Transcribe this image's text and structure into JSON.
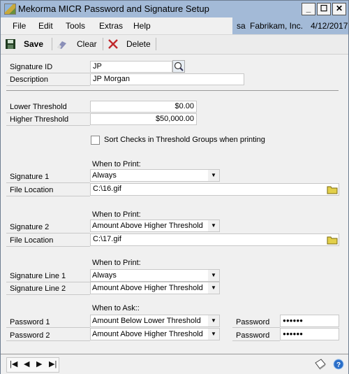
{
  "window": {
    "title": "Mekorma MICR Password and Signature Setup",
    "controls": {
      "minimize": "_",
      "maximize": "☐",
      "close": "✕"
    }
  },
  "menubar": {
    "items": [
      "File",
      "Edit",
      "Tools",
      "Extras",
      "Help"
    ],
    "user": "sa",
    "company": "Fabrikam, Inc.",
    "date": "4/12/2017"
  },
  "toolbar": {
    "save_label": "Save",
    "clear_label": "Clear",
    "delete_label": "Delete"
  },
  "form": {
    "signature_id": {
      "label": "Signature ID",
      "value": "JP"
    },
    "description": {
      "label": "Description",
      "value": "JP Morgan"
    },
    "lower_threshold": {
      "label": "Lower Threshold",
      "value": "$0.00"
    },
    "higher_threshold": {
      "label": "Higher Threshold",
      "value": "$50,000.00"
    },
    "sort_checks": {
      "label": "Sort Checks in Threshold Groups when printing",
      "checked": false
    },
    "signature1": {
      "when_label": "When to Print:",
      "label": "Signature 1",
      "value": "Always",
      "file_label": "File Location",
      "file_value": "C:\\16.gif"
    },
    "signature2": {
      "when_label": "When to Print:",
      "label": "Signature 2",
      "value": "Amount Above Higher Threshold",
      "file_label": "File Location",
      "file_value": "C:\\17.gif"
    },
    "signature_lines": {
      "when_label": "When to Print:",
      "line1_label": "Signature Line 1",
      "line1_value": "Always",
      "line2_label": "Signature Line 2",
      "line2_value": "Amount Above Higher Threshold"
    },
    "passwords": {
      "when_label": "When to Ask::",
      "p1_label": "Password 1",
      "p1_value": "Amount Below Lower Threshold",
      "p2_label": "Password 2",
      "p2_value": "Amount Above Higher Threshold",
      "pw_label": "Password",
      "pw1_value": "●●●●●●",
      "pw2_value": "●●●●●●"
    }
  },
  "statusbar": {
    "nav": {
      "first": "|◀",
      "prev": "◀",
      "next": "▶",
      "last": "▶|"
    }
  }
}
